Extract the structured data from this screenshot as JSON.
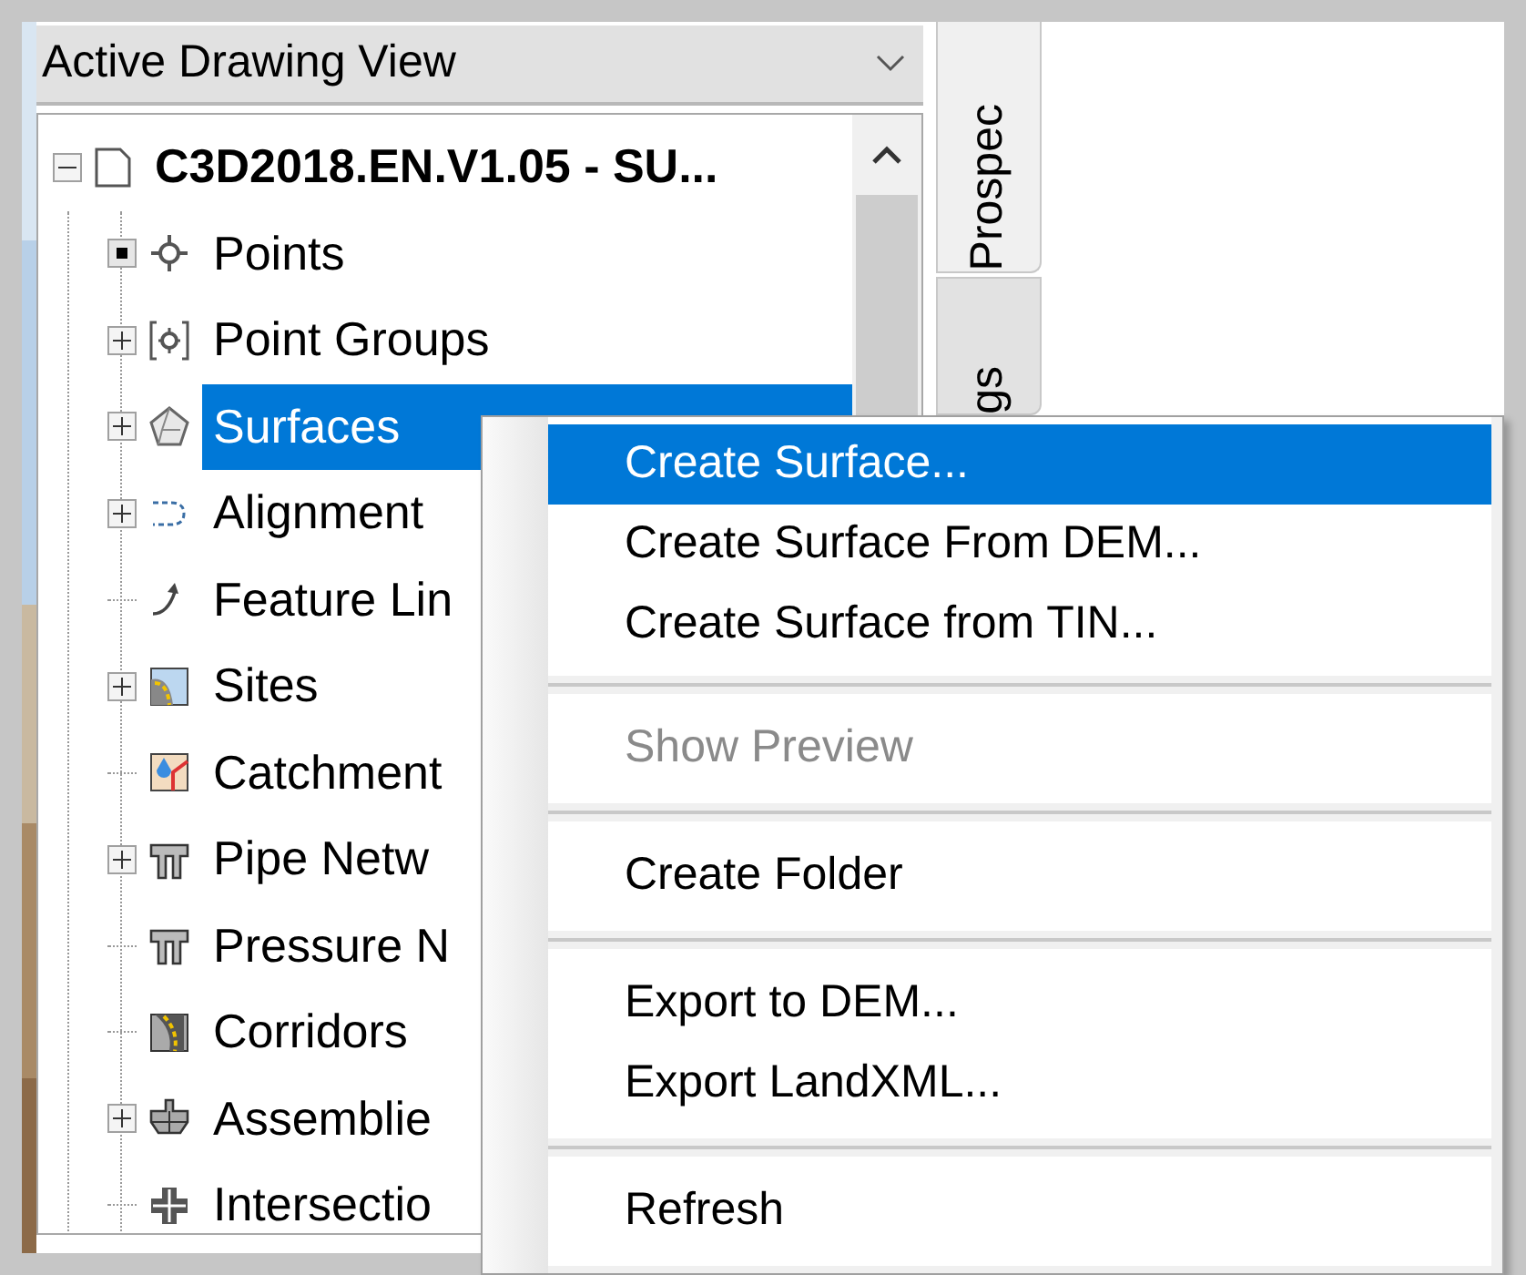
{
  "view_dropdown": {
    "value": "Active Drawing View"
  },
  "tree": {
    "label": "C3D2018.EN.V1.05 - SU...",
    "expanded": true,
    "selected": false,
    "children": [
      {
        "label": "Points",
        "kind": "marked",
        "selected": false
      },
      {
        "label": "Point Groups",
        "kind": "collapsed",
        "selected": false
      },
      {
        "label": "Surfaces",
        "kind": "collapsed",
        "selected": true
      },
      {
        "label": "Alignment",
        "kind": "collapsed",
        "selected": false
      },
      {
        "label": "Feature Lin",
        "kind": "leaf",
        "selected": false
      },
      {
        "label": "Sites",
        "kind": "collapsed",
        "selected": false
      },
      {
        "label": "Catchment",
        "kind": "leaf",
        "selected": false
      },
      {
        "label": "Pipe Netw",
        "kind": "collapsed",
        "selected": false
      },
      {
        "label": "Pressure N",
        "kind": "leaf",
        "selected": false
      },
      {
        "label": "Corridors",
        "kind": "leaf",
        "selected": false
      },
      {
        "label": "Assemblie",
        "kind": "collapsed",
        "selected": false
      },
      {
        "label": "Intersectio",
        "kind": "leaf",
        "selected": false
      }
    ]
  },
  "side_tabs": [
    {
      "label": "Prospec",
      "selected": true
    },
    {
      "label": "gs",
      "selected": false
    }
  ],
  "context_menu": {
    "groups": [
      [
        {
          "label": "Create Surface...",
          "selected": true,
          "disabled": false
        },
        {
          "label": "Create Surface From DEM...",
          "selected": false,
          "disabled": false
        },
        {
          "label": "Create Surface from TIN...",
          "selected": false,
          "disabled": false
        }
      ],
      [
        {
          "label": "Show Preview",
          "selected": false,
          "disabled": true
        }
      ],
      [
        {
          "label": "Create Folder",
          "selected": false,
          "disabled": false
        }
      ],
      [
        {
          "label": "Export to DEM...",
          "selected": false,
          "disabled": false
        },
        {
          "label": "Export LandXML...",
          "selected": false,
          "disabled": false
        }
      ],
      [
        {
          "label": "Refresh",
          "selected": false,
          "disabled": false
        }
      ]
    ]
  }
}
